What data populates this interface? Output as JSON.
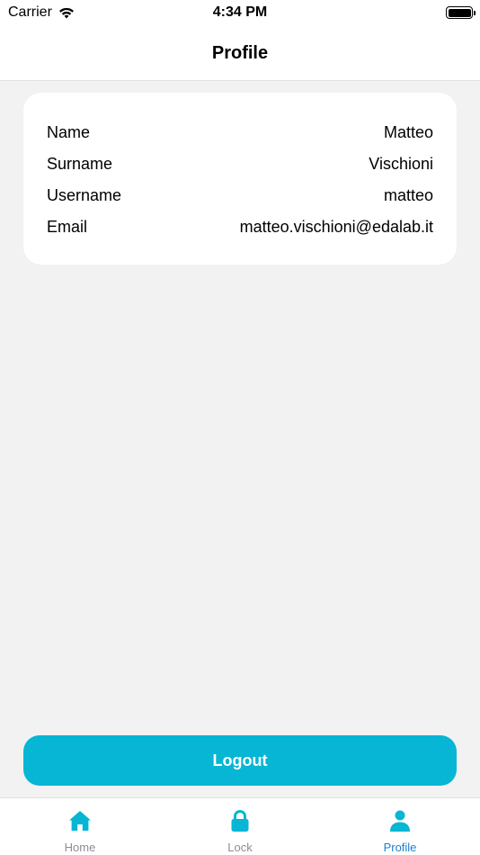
{
  "status_bar": {
    "carrier": "Carrier",
    "time": "4:34 PM"
  },
  "nav": {
    "title": "Profile"
  },
  "profile": {
    "rows": [
      {
        "label": "Name",
        "value": "Matteo"
      },
      {
        "label": "Surname",
        "value": "Vischioni"
      },
      {
        "label": "Username",
        "value": "matteo"
      },
      {
        "label": "Email",
        "value": "matteo.vischioni@edalab.it"
      }
    ]
  },
  "logout": {
    "label": "Logout"
  },
  "tabs": [
    {
      "label": "Home",
      "icon": "home-icon",
      "active": false
    },
    {
      "label": "Lock",
      "icon": "lock-icon",
      "active": false
    },
    {
      "label": "Profile",
      "icon": "person-icon",
      "active": true
    }
  ],
  "colors": {
    "accent": "#06b6d4",
    "active_tab_label": "#1b7fd6",
    "inactive_tab_label": "#8e8e93",
    "background": "#f2f2f2"
  }
}
